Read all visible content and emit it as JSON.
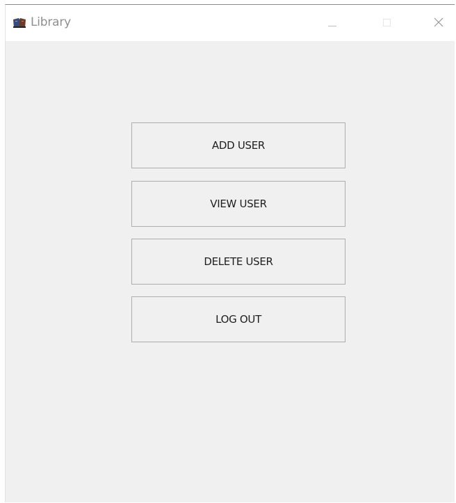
{
  "window": {
    "title": "Library",
    "app_icon": "books-icon",
    "controls": {
      "minimize_icon": "minimize-icon",
      "maximize_icon": "maximize-icon",
      "close_icon": "close-icon"
    }
  },
  "menu": {
    "buttons": [
      {
        "label": "ADD USER"
      },
      {
        "label": "VIEW USER"
      },
      {
        "label": "DELETE USER"
      },
      {
        "label": "LOG OUT"
      }
    ]
  },
  "colors": {
    "background": "#f0f0f0",
    "titlebar": "#ffffff",
    "button_border": "#adadad",
    "button_text": "#1e1e1e",
    "title_text": "#8f8f8f"
  }
}
